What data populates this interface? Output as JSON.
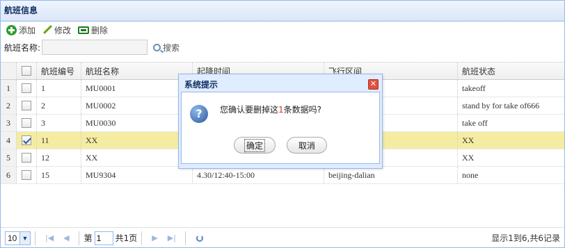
{
  "panel": {
    "title": "航班信息"
  },
  "toolbar": {
    "add_label": "添加",
    "edit_label": "修改",
    "delete_label": "删除"
  },
  "search": {
    "label": "航班名称:",
    "value": "",
    "button_label": "搜索"
  },
  "table": {
    "headers": [
      "航班编号",
      "航班名称",
      "起降时间",
      "飞行区间",
      "航班状态"
    ],
    "rows": [
      {
        "rownum": "1",
        "no": "1",
        "name": "MU0001",
        "time": "",
        "range": "",
        "status": "takeoff",
        "checked": false
      },
      {
        "rownum": "2",
        "no": "2",
        "name": "MU0002",
        "time": "",
        "range": "",
        "status": "stand by for take of666",
        "checked": false
      },
      {
        "rownum": "3",
        "no": "3",
        "name": "MU0030",
        "time": "",
        "range": "",
        "status": "take off",
        "checked": false
      },
      {
        "rownum": "4",
        "no": "11",
        "name": "XX",
        "time": "",
        "range": "",
        "status": "XX",
        "checked": true
      },
      {
        "rownum": "5",
        "no": "12",
        "name": "XX",
        "time": "",
        "range": "",
        "status": "XX",
        "checked": false
      },
      {
        "rownum": "6",
        "no": "15",
        "name": "MU9304",
        "time": "4.30/12:40-15:00",
        "range": "beijing-dalian",
        "status": "none",
        "checked": false
      }
    ]
  },
  "pager": {
    "page_size": "10",
    "page_prefix": "第",
    "page_value": "1",
    "page_total": "共1页",
    "info": "显示1到6,共6记录"
  },
  "dialog": {
    "title": "系统提示",
    "msg_before": "您确认要删掉这",
    "msg_count": "1",
    "msg_after": "条数据吗?",
    "ok_label": "确定",
    "cancel_label": "取消"
  }
}
